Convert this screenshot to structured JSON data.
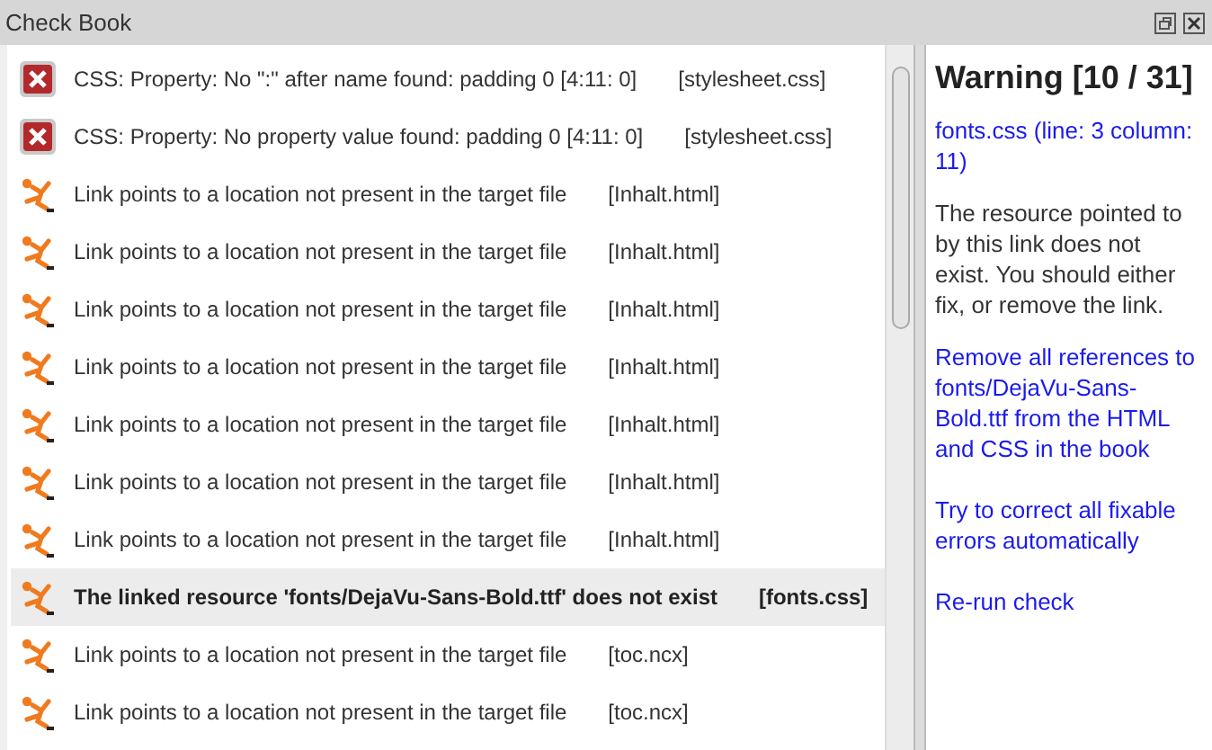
{
  "window": {
    "title": "Check Book"
  },
  "items": [
    {
      "kind": "error",
      "message": "CSS: Property: No \":\" after name found: padding 0 [4:11: 0]",
      "file": "[stylesheet.css]",
      "selected": false
    },
    {
      "kind": "error",
      "message": "CSS: Property: No property value found: padding 0 [4:11: 0]",
      "file": "[stylesheet.css]",
      "selected": false
    },
    {
      "kind": "warning",
      "message": "Link points to a location not present in the target file",
      "file": "[Inhalt.html]",
      "selected": false
    },
    {
      "kind": "warning",
      "message": "Link points to a location not present in the target file",
      "file": "[Inhalt.html]",
      "selected": false
    },
    {
      "kind": "warning",
      "message": "Link points to a location not present in the target file",
      "file": "[Inhalt.html]",
      "selected": false
    },
    {
      "kind": "warning",
      "message": "Link points to a location not present in the target file",
      "file": "[Inhalt.html]",
      "selected": false
    },
    {
      "kind": "warning",
      "message": "Link points to a location not present in the target file",
      "file": "[Inhalt.html]",
      "selected": false
    },
    {
      "kind": "warning",
      "message": "Link points to a location not present in the target file",
      "file": "[Inhalt.html]",
      "selected": false
    },
    {
      "kind": "warning",
      "message": "Link points to a location not present in the target file",
      "file": "[Inhalt.html]",
      "selected": false
    },
    {
      "kind": "warning",
      "message": "The linked resource 'fonts/DejaVu-Sans-Bold.ttf' does not exist",
      "file": "[fonts.css]",
      "selected": true
    },
    {
      "kind": "warning",
      "message": "Link points to a location not present in the target file",
      "file": "[toc.ncx]",
      "selected": false
    },
    {
      "kind": "warning",
      "message": "Link points to a location not present in the target file",
      "file": "[toc.ncx]",
      "selected": false
    }
  ],
  "details": {
    "heading": "Warning [10 / 31]",
    "location": "fonts.css (line: 3 column: 11)",
    "description": "The resource pointed to by this link does not exist. You should either fix, or remove the link.",
    "actions": [
      "Remove all references to fonts/DejaVu-Sans-Bold.ttf from the HTML and CSS in the book",
      "Try to correct all fixable errors automatically",
      "Re-run check"
    ]
  }
}
